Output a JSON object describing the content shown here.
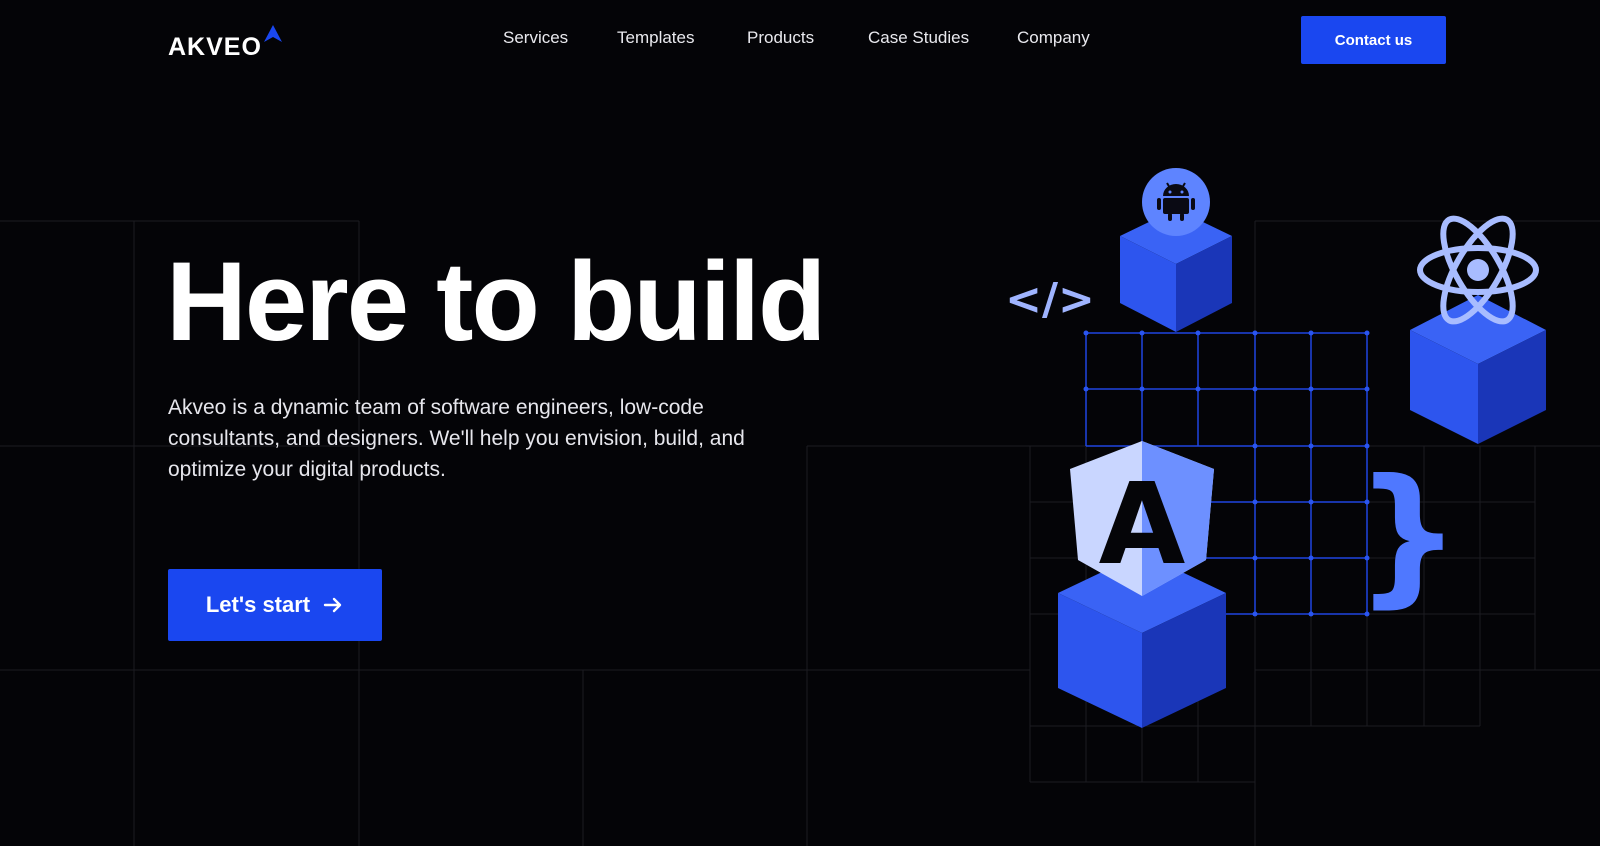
{
  "brand": {
    "name": "AKVEO",
    "accent_color": "#1a47f0"
  },
  "nav": {
    "items": [
      {
        "label": "Services"
      },
      {
        "label": "Templates"
      },
      {
        "label": "Products"
      },
      {
        "label": "Case Studies"
      },
      {
        "label": "Company"
      }
    ],
    "contact_label": "Contact us"
  },
  "hero": {
    "title": "Here to build",
    "description": "Akveo is a dynamic team of software engineers, low-code consultants, and designers. We'll help you envision, build, and optimize your digital products.",
    "cta_label": "Let's start",
    "cta_icon": "arrow-right-icon"
  },
  "illustration": {
    "code_tag": "</>",
    "brace": "}",
    "angular_letter": "A",
    "icons": [
      "android-icon",
      "react-icon",
      "angular-icon",
      "code-tag-icon",
      "curly-brace-icon"
    ]
  }
}
